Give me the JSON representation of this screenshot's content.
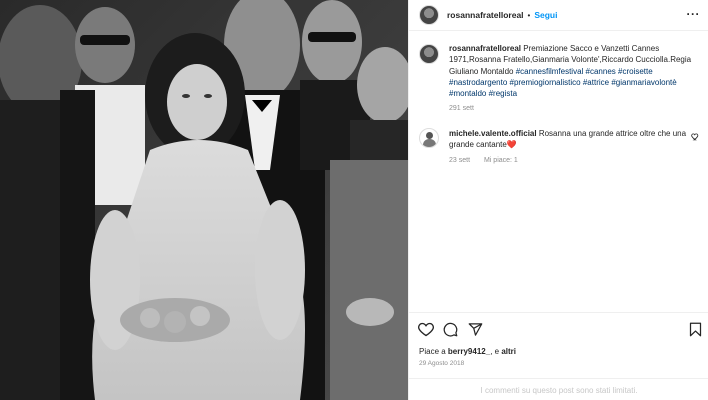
{
  "post": {
    "username": "rosannafratelloreal",
    "follow_label": "Segui",
    "more_icon": "more-horizontal-icon",
    "caption": {
      "username": "rosannafratelloreal",
      "text": "Premiazione Sacco e Vanzetti Cannes 1971,Rosanna Fratello,Gianmaria Volonte',Riccardo Cucciolla.Regia Giuliano Montaldo",
      "hashtags": "#cannesfilmfestival #cannes #croisette #nastrodargento #premiogiornalistico #attrice #gianmariavolontè #montaldo #regista",
      "time": "291 sett"
    },
    "comment": {
      "username": "michele.valente.official",
      "text": "Rosanna una grande attrice oltre che una grande cantante❤️",
      "time": "23 sett",
      "likes": "Mi piace: 1"
    },
    "likes": {
      "prefix": "Piace a",
      "user": "berry9412_",
      "middle": "e",
      "others": "altri"
    },
    "date": "29 Agosto 2018",
    "footer": "I commenti su questo post sono stati limitati."
  },
  "icons": [
    "heart-icon",
    "comment-icon",
    "share-icon",
    "bookmark-icon"
  ]
}
